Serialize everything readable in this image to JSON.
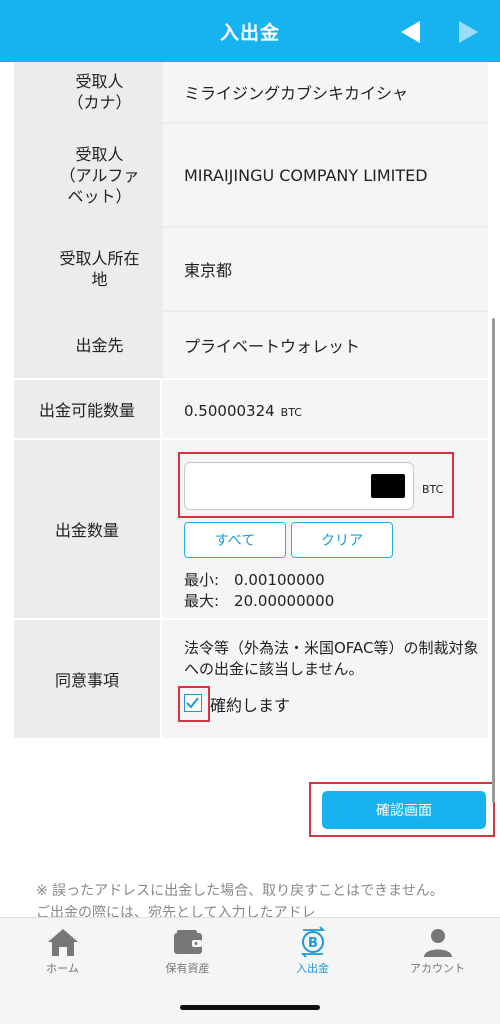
{
  "header": {
    "title": "入出金"
  },
  "recipient_rows": [
    {
      "label": "受取人\n（カナ）",
      "value": "ミライジングカブシキカイシャ"
    },
    {
      "label": "受取人\n（アルファ\nベット）",
      "value": "MIRAIJINGU COMPANY LIMITED"
    },
    {
      "label": "受取人所在\n地",
      "value": "東京都"
    },
    {
      "label": "出金先",
      "value": "プライベートウォレット"
    }
  ],
  "available": {
    "label": "出金可能数量",
    "value": "0.50000324",
    "unit": "BTC"
  },
  "amount": {
    "label": "出金数量",
    "input_value": "",
    "unit": "BTC",
    "all_button": "すべて",
    "clear_button": "クリア",
    "min_text": "最小:　0.00100000",
    "max_text": "最大:　20.00000000"
  },
  "agreement": {
    "label": "同意事項",
    "text": "法令等（外為法・米国OFAC等）の制裁対象への出金に該当しません。",
    "checkbox_label": "確約します",
    "checked": true
  },
  "confirm_button": "確認画面",
  "note": "※ 誤ったアドレスに出金した場合、取り戻すことはできません。ご出金の際には、宛先として入力したアドレ",
  "tabs": [
    {
      "label": "ホーム",
      "icon": "home-icon",
      "active": false
    },
    {
      "label": "保有資産",
      "icon": "wallet-icon",
      "active": false
    },
    {
      "label": "入出金",
      "icon": "bitcoin-transfer-icon",
      "active": true
    },
    {
      "label": "アカウント",
      "icon": "account-icon",
      "active": false
    }
  ],
  "colors": {
    "accent": "#17b3f0",
    "highlight": "#d9333f",
    "label_bg": "#ececec",
    "value_bg": "#f5f5f5"
  }
}
